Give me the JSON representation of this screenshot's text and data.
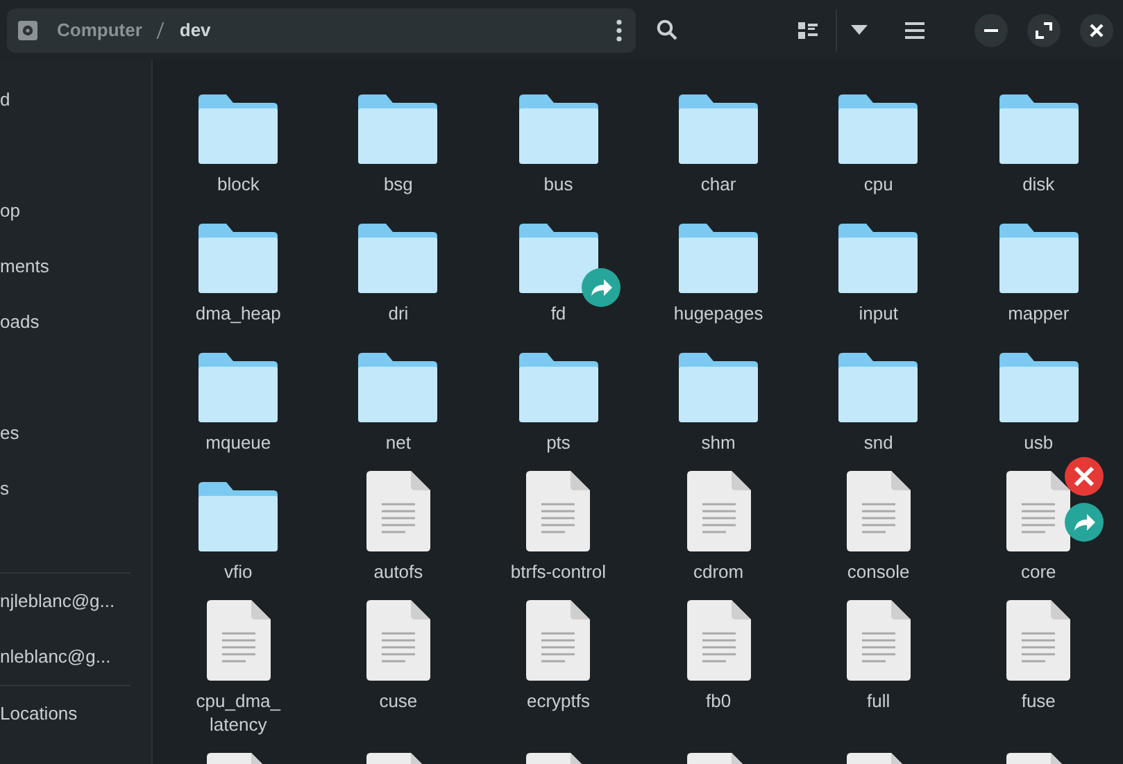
{
  "path": {
    "segments": [
      {
        "label": "Computer",
        "selected": false
      },
      {
        "label": "dev",
        "selected": true
      }
    ]
  },
  "sidebar": {
    "groups": [
      [
        "d"
      ],
      [
        "op",
        "ments",
        "oads"
      ],
      [
        "es",
        "s"
      ]
    ],
    "accounts": [
      "njleblanc@g...",
      "nleblanc@g..."
    ],
    "other": "Locations"
  },
  "items": [
    {
      "kind": "folder",
      "name": "block"
    },
    {
      "kind": "folder",
      "name": "bsg"
    },
    {
      "kind": "folder",
      "name": "bus"
    },
    {
      "kind": "folder",
      "name": "char"
    },
    {
      "kind": "folder",
      "name": "cpu"
    },
    {
      "kind": "folder",
      "name": "disk"
    },
    {
      "kind": "folder",
      "name": "dma_heap"
    },
    {
      "kind": "folder",
      "name": "dri"
    },
    {
      "kind": "folder",
      "name": "fd",
      "link": true,
      "unreadable": false
    },
    {
      "kind": "folder",
      "name": "hugepages"
    },
    {
      "kind": "folder",
      "name": "input"
    },
    {
      "kind": "folder",
      "name": "mapper"
    },
    {
      "kind": "folder",
      "name": "mqueue"
    },
    {
      "kind": "folder",
      "name": "net"
    },
    {
      "kind": "folder",
      "name": "pts"
    },
    {
      "kind": "folder",
      "name": "shm"
    },
    {
      "kind": "folder",
      "name": "snd"
    },
    {
      "kind": "folder",
      "name": "usb"
    },
    {
      "kind": "folder",
      "name": "vfio"
    },
    {
      "kind": "file",
      "name": "autofs"
    },
    {
      "kind": "file",
      "name": "btrfs-control"
    },
    {
      "kind": "file",
      "name": "cdrom"
    },
    {
      "kind": "file",
      "name": "console"
    },
    {
      "kind": "file",
      "name": "core",
      "link": true,
      "unreadable": true
    },
    {
      "kind": "file",
      "name": "cpu_dma_\nlatency"
    },
    {
      "kind": "file",
      "name": "cuse"
    },
    {
      "kind": "file",
      "name": "ecryptfs"
    },
    {
      "kind": "file",
      "name": "fb0"
    },
    {
      "kind": "file",
      "name": "full"
    },
    {
      "kind": "file",
      "name": "fuse"
    },
    {
      "kind": "file"
    },
    {
      "kind": "file"
    },
    {
      "kind": "file"
    },
    {
      "kind": "file"
    },
    {
      "kind": "file"
    },
    {
      "kind": "file"
    }
  ]
}
